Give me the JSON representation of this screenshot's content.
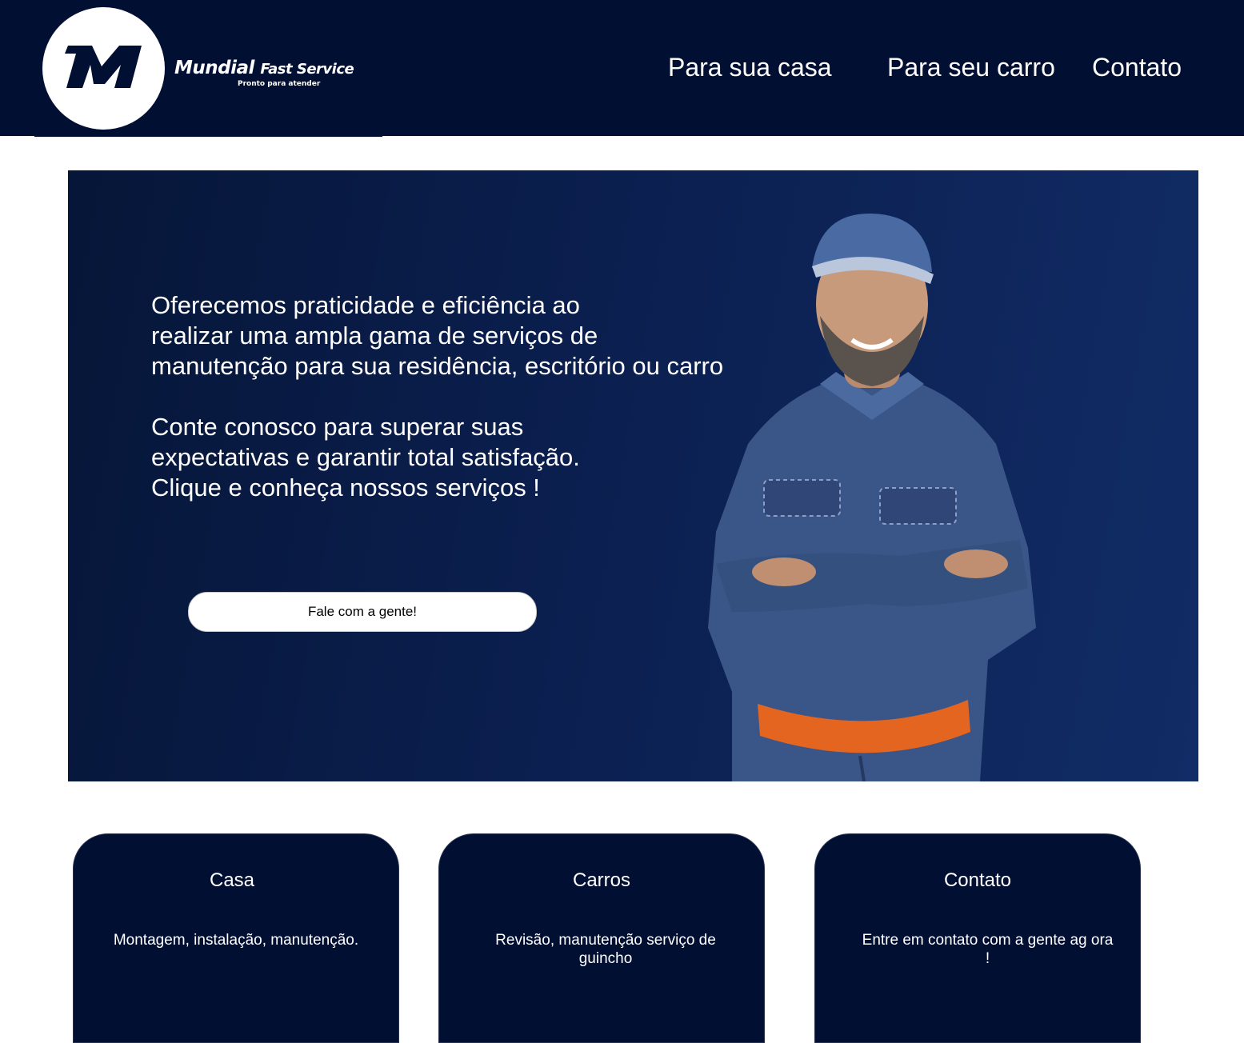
{
  "header": {
    "brand_name": "Mundial",
    "brand_suffix": "Fast Service",
    "tagline": "Pronto para atender",
    "nav": [
      {
        "label": "Para sua casa"
      },
      {
        "label": "Para seu carro"
      },
      {
        "label": "Contato"
      }
    ]
  },
  "hero": {
    "lines_1": [
      "Oferecemos praticidade e eficiência ao",
      "realizar uma ampla gama de serviços de",
      "manutenção para sua residência, escritório ou carro"
    ],
    "lines_2": [
      "Conte conosco para superar suas",
      "expectativas e garantir total satisfação.",
      "Clique e conheça nossos serviços !"
    ],
    "cta_label": "Fale com a gente!"
  },
  "cards": [
    {
      "title": "Casa",
      "description": "Montagem, instalação, manutenção."
    },
    {
      "title": "Carros",
      "description": "Revisão, manutenção serviço de guincho"
    },
    {
      "title": "Contato",
      "description": "Entre em contato com a gente ag ora !"
    }
  ],
  "colors": {
    "navy": "#010f33",
    "hero_start": "#061638",
    "hero_end": "#112c66",
    "accent_orange": "#e4651f"
  }
}
